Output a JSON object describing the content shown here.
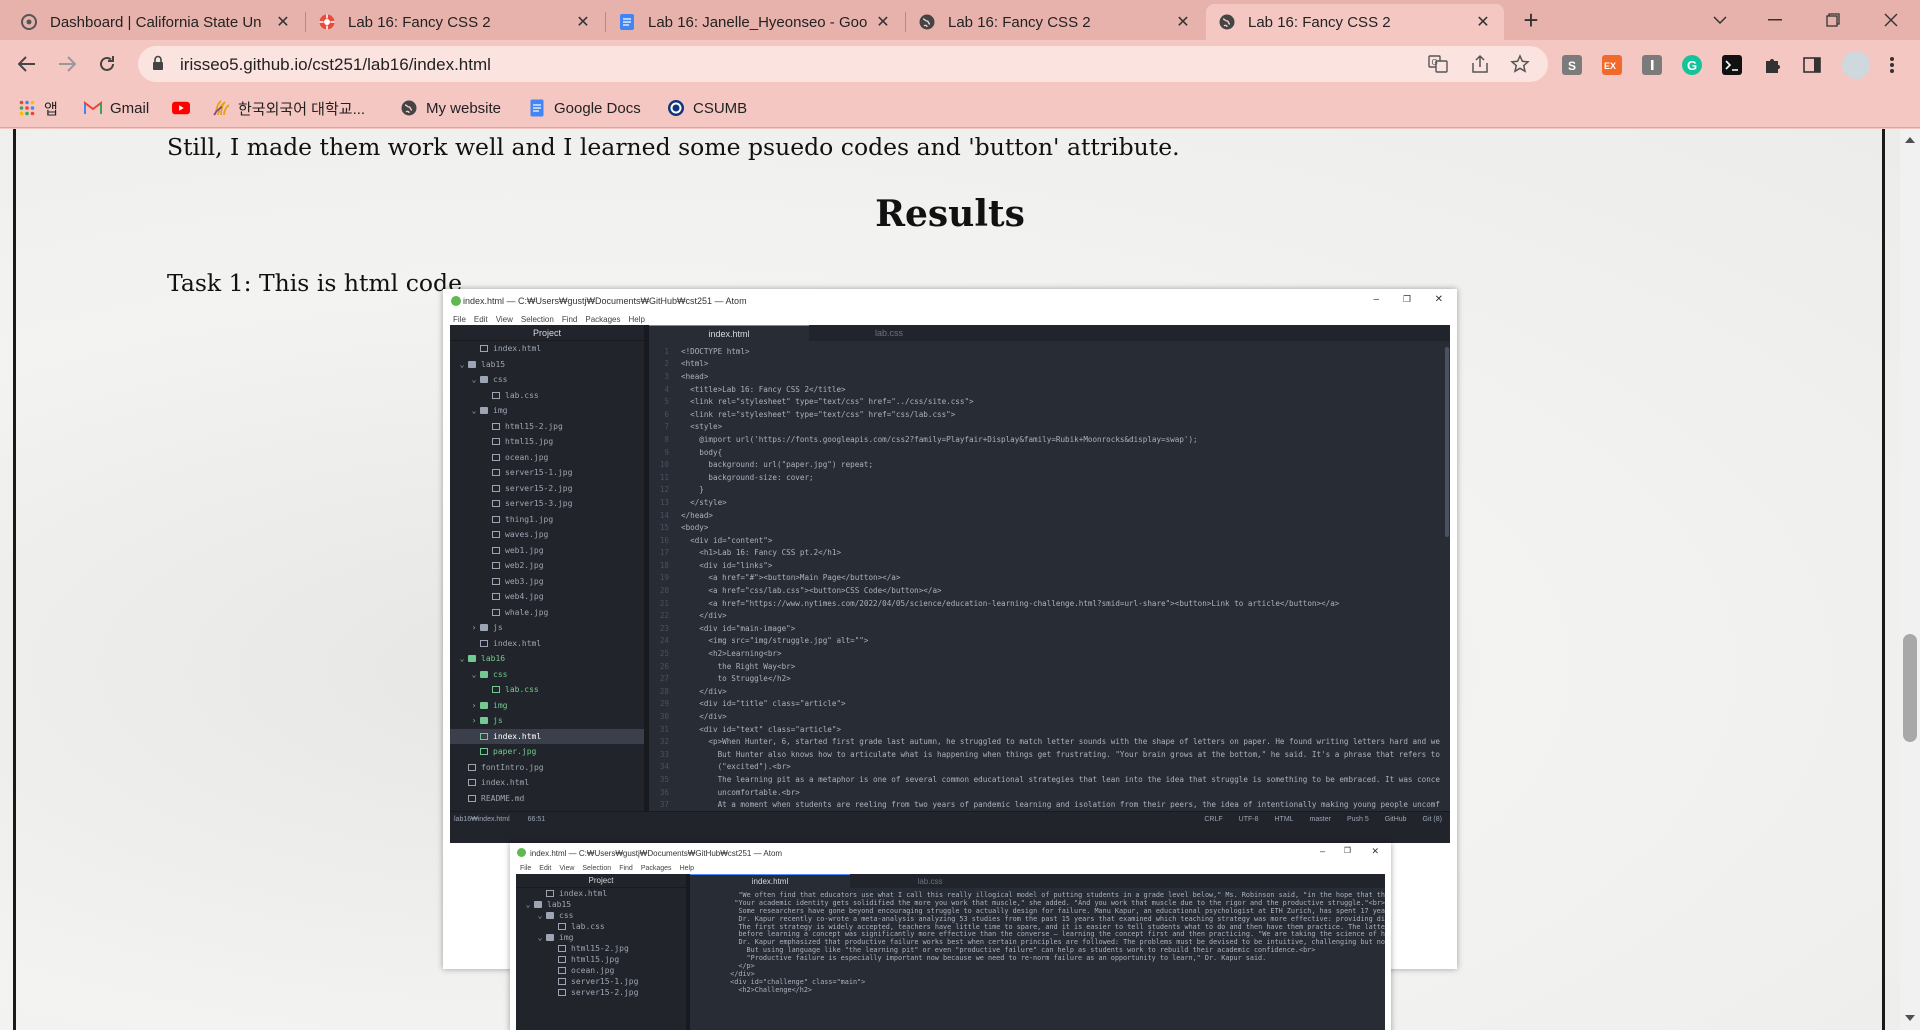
{
  "browser": {
    "tabs": [
      {
        "title": "Dashboard | California State Un",
        "icon": "canvas-icon",
        "active": false
      },
      {
        "title": "Lab 16: Fancy CSS 2",
        "icon": "pinwheel-icon",
        "active": false
      },
      {
        "title": "Lab 16: Janelle_Hyeonseo - Goo",
        "icon": "google-docs-icon",
        "active": false
      },
      {
        "title": "Lab 16: Fancy CSS 2",
        "icon": "globe-icon",
        "active": false
      },
      {
        "title": "Lab 16: Fancy CSS 2",
        "icon": "globe-icon",
        "active": true
      }
    ],
    "url": "irisseo5.github.io/cst251/lab16/index.html",
    "bookmarks": [
      {
        "label": "앱",
        "icon": "apps-grid-icon"
      },
      {
        "label": "Gmail",
        "icon": "gmail-icon"
      },
      {
        "label": "",
        "icon": "youtube-icon"
      },
      {
        "label": "한국외국어 대학교...",
        "icon": "hufs-icon"
      },
      {
        "label": "My website",
        "icon": "globe-icon"
      },
      {
        "label": "Google Docs",
        "icon": "google-docs-icon"
      },
      {
        "label": "CSUMB",
        "icon": "csumb-icon"
      }
    ]
  },
  "page": {
    "intro_text": "Still, I made them work well and I learned some psuedo codes and 'button' attribute.",
    "results_heading": "Results",
    "task1_text": "Task 1: This is html code"
  },
  "screenshot1": {
    "window_title": "index.html — C:₩Users₩gustj₩Documents₩GitHub₩cst251 — Atom",
    "menu": [
      "File",
      "Edit",
      "View",
      "Selection",
      "Find",
      "Packages",
      "Help"
    ],
    "tree_header": "Project",
    "tabs": [
      "index.html",
      "lab.css"
    ],
    "tree": [
      {
        "name": "index.html",
        "indent": 2,
        "type": "file"
      },
      {
        "name": "lab15",
        "indent": 1,
        "type": "folder",
        "open": true
      },
      {
        "name": "css",
        "indent": 2,
        "type": "folder",
        "open": true
      },
      {
        "name": "lab.css",
        "indent": 3,
        "type": "file"
      },
      {
        "name": "img",
        "indent": 2,
        "type": "folder",
        "open": true
      },
      {
        "name": "html15-2.jpg",
        "indent": 3,
        "type": "file"
      },
      {
        "name": "html15.jpg",
        "indent": 3,
        "type": "file"
      },
      {
        "name": "ocean.jpg",
        "indent": 3,
        "type": "file"
      },
      {
        "name": "server15-1.jpg",
        "indent": 3,
        "type": "file"
      },
      {
        "name": "server15-2.jpg",
        "indent": 3,
        "type": "file"
      },
      {
        "name": "server15-3.jpg",
        "indent": 3,
        "type": "file"
      },
      {
        "name": "thing1.jpg",
        "indent": 3,
        "type": "file"
      },
      {
        "name": "waves.jpg",
        "indent": 3,
        "type": "file"
      },
      {
        "name": "web1.jpg",
        "indent": 3,
        "type": "file"
      },
      {
        "name": "web2.jpg",
        "indent": 3,
        "type": "file"
      },
      {
        "name": "web3.jpg",
        "indent": 3,
        "type": "file"
      },
      {
        "name": "web4.jpg",
        "indent": 3,
        "type": "file"
      },
      {
        "name": "whale.jpg",
        "indent": 3,
        "type": "file"
      },
      {
        "name": "js",
        "indent": 2,
        "type": "folder",
        "open": false
      },
      {
        "name": "index.html",
        "indent": 2,
        "type": "file"
      },
      {
        "name": "lab16",
        "indent": 1,
        "type": "folder",
        "open": true,
        "green": true
      },
      {
        "name": "css",
        "indent": 2,
        "type": "folder",
        "open": true,
        "green": true
      },
      {
        "name": "lab.css",
        "indent": 3,
        "type": "file",
        "green": true
      },
      {
        "name": "img",
        "indent": 2,
        "type": "folder",
        "open": false,
        "green": true
      },
      {
        "name": "js",
        "indent": 2,
        "type": "folder",
        "open": false,
        "green": true
      },
      {
        "name": "index.html",
        "indent": 2,
        "type": "file",
        "green": true,
        "selected": true
      },
      {
        "name": "paper.jpg",
        "indent": 2,
        "type": "file",
        "green": true
      },
      {
        "name": "fontIntro.jpg",
        "indent": 1,
        "type": "file"
      },
      {
        "name": "index.html",
        "indent": 1,
        "type": "file"
      },
      {
        "name": "README.md",
        "indent": 1,
        "type": "file"
      }
    ],
    "code": [
      "<!DOCTYPE html>",
      "<html>",
      "<head>",
      "  <title>Lab 16: Fancy CSS 2</title>",
      "  <link rel=\"stylesheet\" type=\"text/css\" href=\"../css/site.css\">",
      "  <link rel=\"stylesheet\" type=\"text/css\" href=\"css/lab.css\">",
      "  <style>",
      "    @import url('https://fonts.googleapis.com/css2?family=Playfair+Display&family=Rubik+Moonrocks&display=swap');",
      "    body{",
      "      background: url(\"paper.jpg\") repeat;",
      "      background-size: cover;",
      "    }",
      "  </style>",
      "</head>",
      "<body>",
      "  <div id=\"content\">",
      "    <h1>Lab 16: Fancy CSS pt.2</h1>",
      "    <div id=\"links\">",
      "      <a href=\"#\"><button>Main Page</button></a>",
      "      <a href=\"css/lab.css\"><button>CSS Code</button></a>",
      "      <a href=\"https://www.nytimes.com/2022/04/05/science/education-learning-challenge.html?smid=url-share\"><button>Link to article</button></a>",
      "    </div>",
      "    <div id=\"main-image\">",
      "      <img src=\"img/struggle.jpg\" alt=\"\">",
      "      <h2>Learning<br>",
      "        the Right Way<br>",
      "        to Struggle</h2>",
      "    </div>",
      "    <div id=\"title\" class=\"article\">",
      "    </div>",
      "    <div id=\"text\" class=\"article\">",
      "      <p>When Hunter, 6, started first grade last autumn, he struggled to match letter sounds with the shape of letters on paper. He found writing letters hard and we",
      "        But Hunter also knows how to articulate what is happening when things get frustrating. \"Your brain grows at the bottom,\" he said. It's a phrase that refers to",
      "        (\"excited\").<br>",
      "        The learning pit as a metaphor is one of several common educational strategies that lean into the idea that struggle is something to be embraced. It was conce",
      "        uncomfortable.<br>",
      "        At a moment when students are reeling from two years of pandemic learning and isolation from their peers, the idea of intentionally making young people uncomf"
    ],
    "status_left": [
      "lab16₩index.html",
      "66:51"
    ],
    "status_right": [
      "CRLF",
      "UTF-8",
      "HTML",
      "",
      "master",
      "Push 5",
      "GitHub",
      "Git (8)"
    ]
  },
  "screenshot2": {
    "window_title": "index.html — C:₩Users₩gustj₩Documents₩GitHub₩cst251 — Atom",
    "menu": [
      "File",
      "Edit",
      "View",
      "Selection",
      "Find",
      "Packages",
      "Help"
    ],
    "tree_header": "Project",
    "tabs": [
      "index.html",
      "lab.css"
    ],
    "tree": [
      {
        "name": "index.html",
        "indent": 2,
        "type": "file"
      },
      {
        "name": "lab15",
        "indent": 1,
        "type": "folder",
        "open": true
      },
      {
        "name": "css",
        "indent": 2,
        "type": "folder",
        "open": true
      },
      {
        "name": "lab.css",
        "indent": 3,
        "type": "file"
      },
      {
        "name": "img",
        "indent": 2,
        "type": "folder",
        "open": true
      },
      {
        "name": "html15-2.jpg",
        "indent": 3,
        "type": "file"
      },
      {
        "name": "html15.jpg",
        "indent": 3,
        "type": "file"
      },
      {
        "name": "ocean.jpg",
        "indent": 3,
        "type": "file"
      },
      {
        "name": "server15-1.jpg",
        "indent": 3,
        "type": "file"
      },
      {
        "name": "server15-2.jpg",
        "indent": 3,
        "type": "file"
      }
    ],
    "code": [
      "      \"We often find that educators use what I call this really illogical model of putting students in a grade level below,\" Ms. Robinson said, \"in the hope that th",
      "      \"Your academic identity gets solidified the more you work that muscle,\" she added. \"And you work that muscle due to the rigor and the productive struggle.\"<br>",
      "      Some researchers have gone beyond encouraging struggle to actually design for failure. Manu Kapur, an educational psychologist at ETH Zurich, has spent 17 yea",
      "      Dr. Kapur recently co-wrote a meta-analysis analyzing 53 studies from the past 15 years that examined which teaching strategy was more effective: providing di",
      "      The first strategy is widely accepted, teachers have little time to spare, and it is easier to tell students what to do and then have them practice. The latte",
      "      before learning a concept was significantly more effective than the converse — learning the concept first and then practicing. \"We are taking the science of h",
      "      Dr. Kapur emphasized that productive failure works best when certain principles are followed: The problems must be devised to be intuitive, challenging but no",
      "      But using language like \"the learning pit\" or even \"productive failure\" can help as students work to rebuild their academic confidence.<br>",
      "      \"Productive failure is especially important now because we need to re-norm failure as an opportunity to learn,\" Dr. Kapur said.",
      "    </p>",
      "  </div>",
      "  <div id=\"challenge\" class=\"main\">",
      "    <h2>Challenge</h2>"
    ]
  }
}
